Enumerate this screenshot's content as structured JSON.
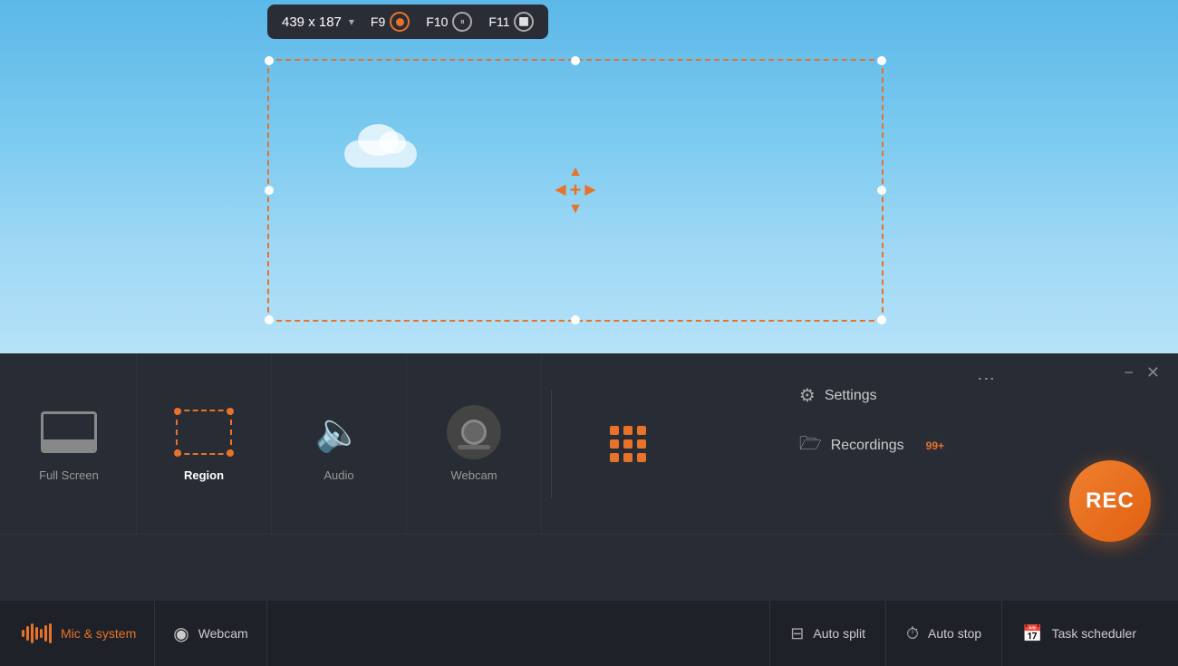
{
  "sky": {
    "cloud": true
  },
  "toolbar_popup": {
    "dimensions": "439 x 187",
    "dropdown_arrow": "▾",
    "f9_label": "F9",
    "f10_label": "F10",
    "f11_label": "F11"
  },
  "selection_box": {
    "visible": true
  },
  "window_controls": {
    "menu_label": "⋮",
    "minimize_label": "−",
    "close_label": "✕"
  },
  "toolbar_items": [
    {
      "id": "full-screen",
      "label": "Full Screen",
      "active": false
    },
    {
      "id": "region",
      "label": "Region",
      "active": true
    },
    {
      "id": "audio",
      "label": "Audio",
      "active": false
    },
    {
      "id": "webcam",
      "label": "Webcam",
      "active": false
    }
  ],
  "right_panel": {
    "settings_label": "Settings",
    "recordings_label": "Recordings",
    "recordings_badge": "99+"
  },
  "rec_button": {
    "label": "REC"
  },
  "status_bar": {
    "mic_system_label": "Mic & system",
    "webcam_label": "Webcam",
    "auto_split_label": "Auto split",
    "auto_stop_label": "Auto stop",
    "task_scheduler_label": "Task scheduler"
  },
  "move_icon": {
    "up": "▲",
    "left": "◀",
    "center": "+",
    "right": "▶",
    "down": "▼"
  },
  "colors": {
    "orange": "#e8722a",
    "dark_bg": "#282c34",
    "darker_bg": "#1e2228",
    "text_active": "#ffffff",
    "text_inactive": "#999999"
  }
}
